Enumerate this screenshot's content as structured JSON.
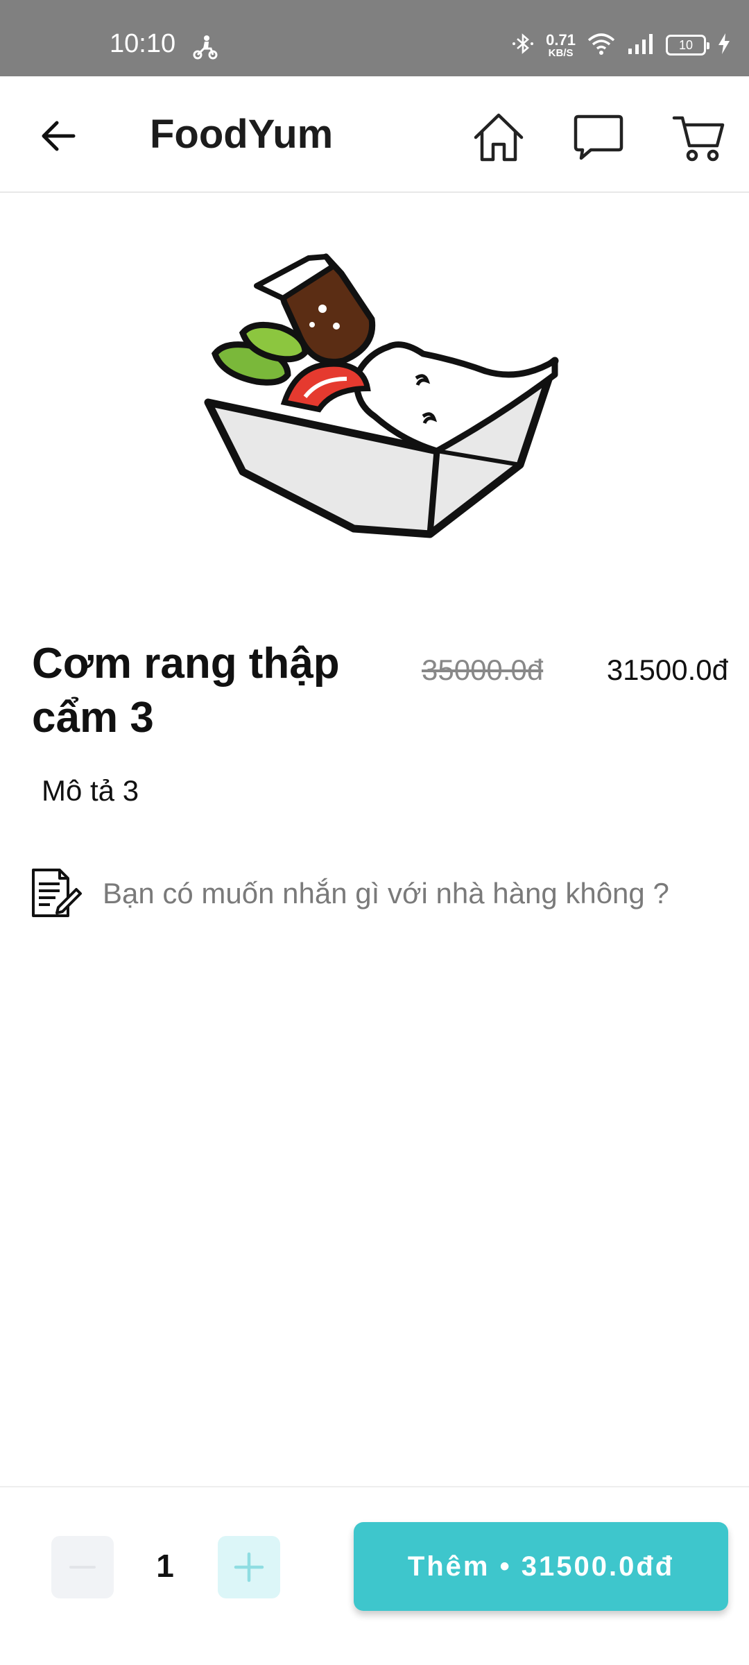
{
  "status_bar": {
    "time": "10:10",
    "net_speed_value": "0.71",
    "net_speed_unit": "KB/S",
    "battery_level": "10",
    "icons": [
      "scooter-icon",
      "bluetooth-icon",
      "wifi-icon",
      "signal-icon",
      "battery-icon",
      "charging-icon"
    ]
  },
  "app_bar": {
    "title": "FoodYum",
    "icons": [
      "back-arrow-icon",
      "home-icon",
      "chat-icon",
      "cart-icon"
    ]
  },
  "product": {
    "name": "Cơm rang thập cẩm 3",
    "old_price": "35000.0đ",
    "new_price": "31500.0đ",
    "description": "Mô tả 3"
  },
  "note": {
    "placeholder": "Bạn có muốn nhắn gì với nhà hàng không ?",
    "value": ""
  },
  "bottom_bar": {
    "quantity": "1",
    "add_label": "Thêm • 31500.0đđ"
  },
  "colors": {
    "accent": "#3ec6cc",
    "status_bar": "#808080",
    "plus_bg": "#dcf6f8",
    "minus_bg": "#f1f3f6"
  }
}
